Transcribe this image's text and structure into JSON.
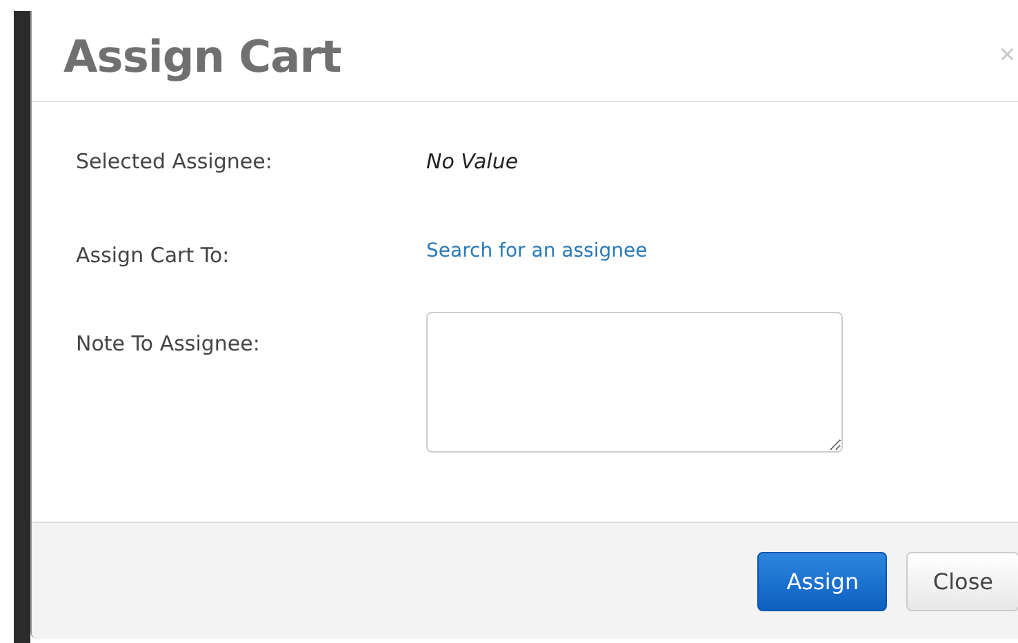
{
  "dialog": {
    "title": "Assign Cart",
    "close_icon": "×"
  },
  "rows": [
    {
      "kind": "value",
      "label": "Selected Assignee:",
      "value": "No Value"
    },
    {
      "kind": "link",
      "label": "Assign Cart To:",
      "value": "Search for an assignee"
    },
    {
      "kind": "textarea",
      "label": "Note To Assignee:"
    }
  ],
  "buttons": [
    {
      "kind": "primary",
      "label": "Assign"
    },
    {
      "kind": "default",
      "label": "Close"
    }
  ]
}
